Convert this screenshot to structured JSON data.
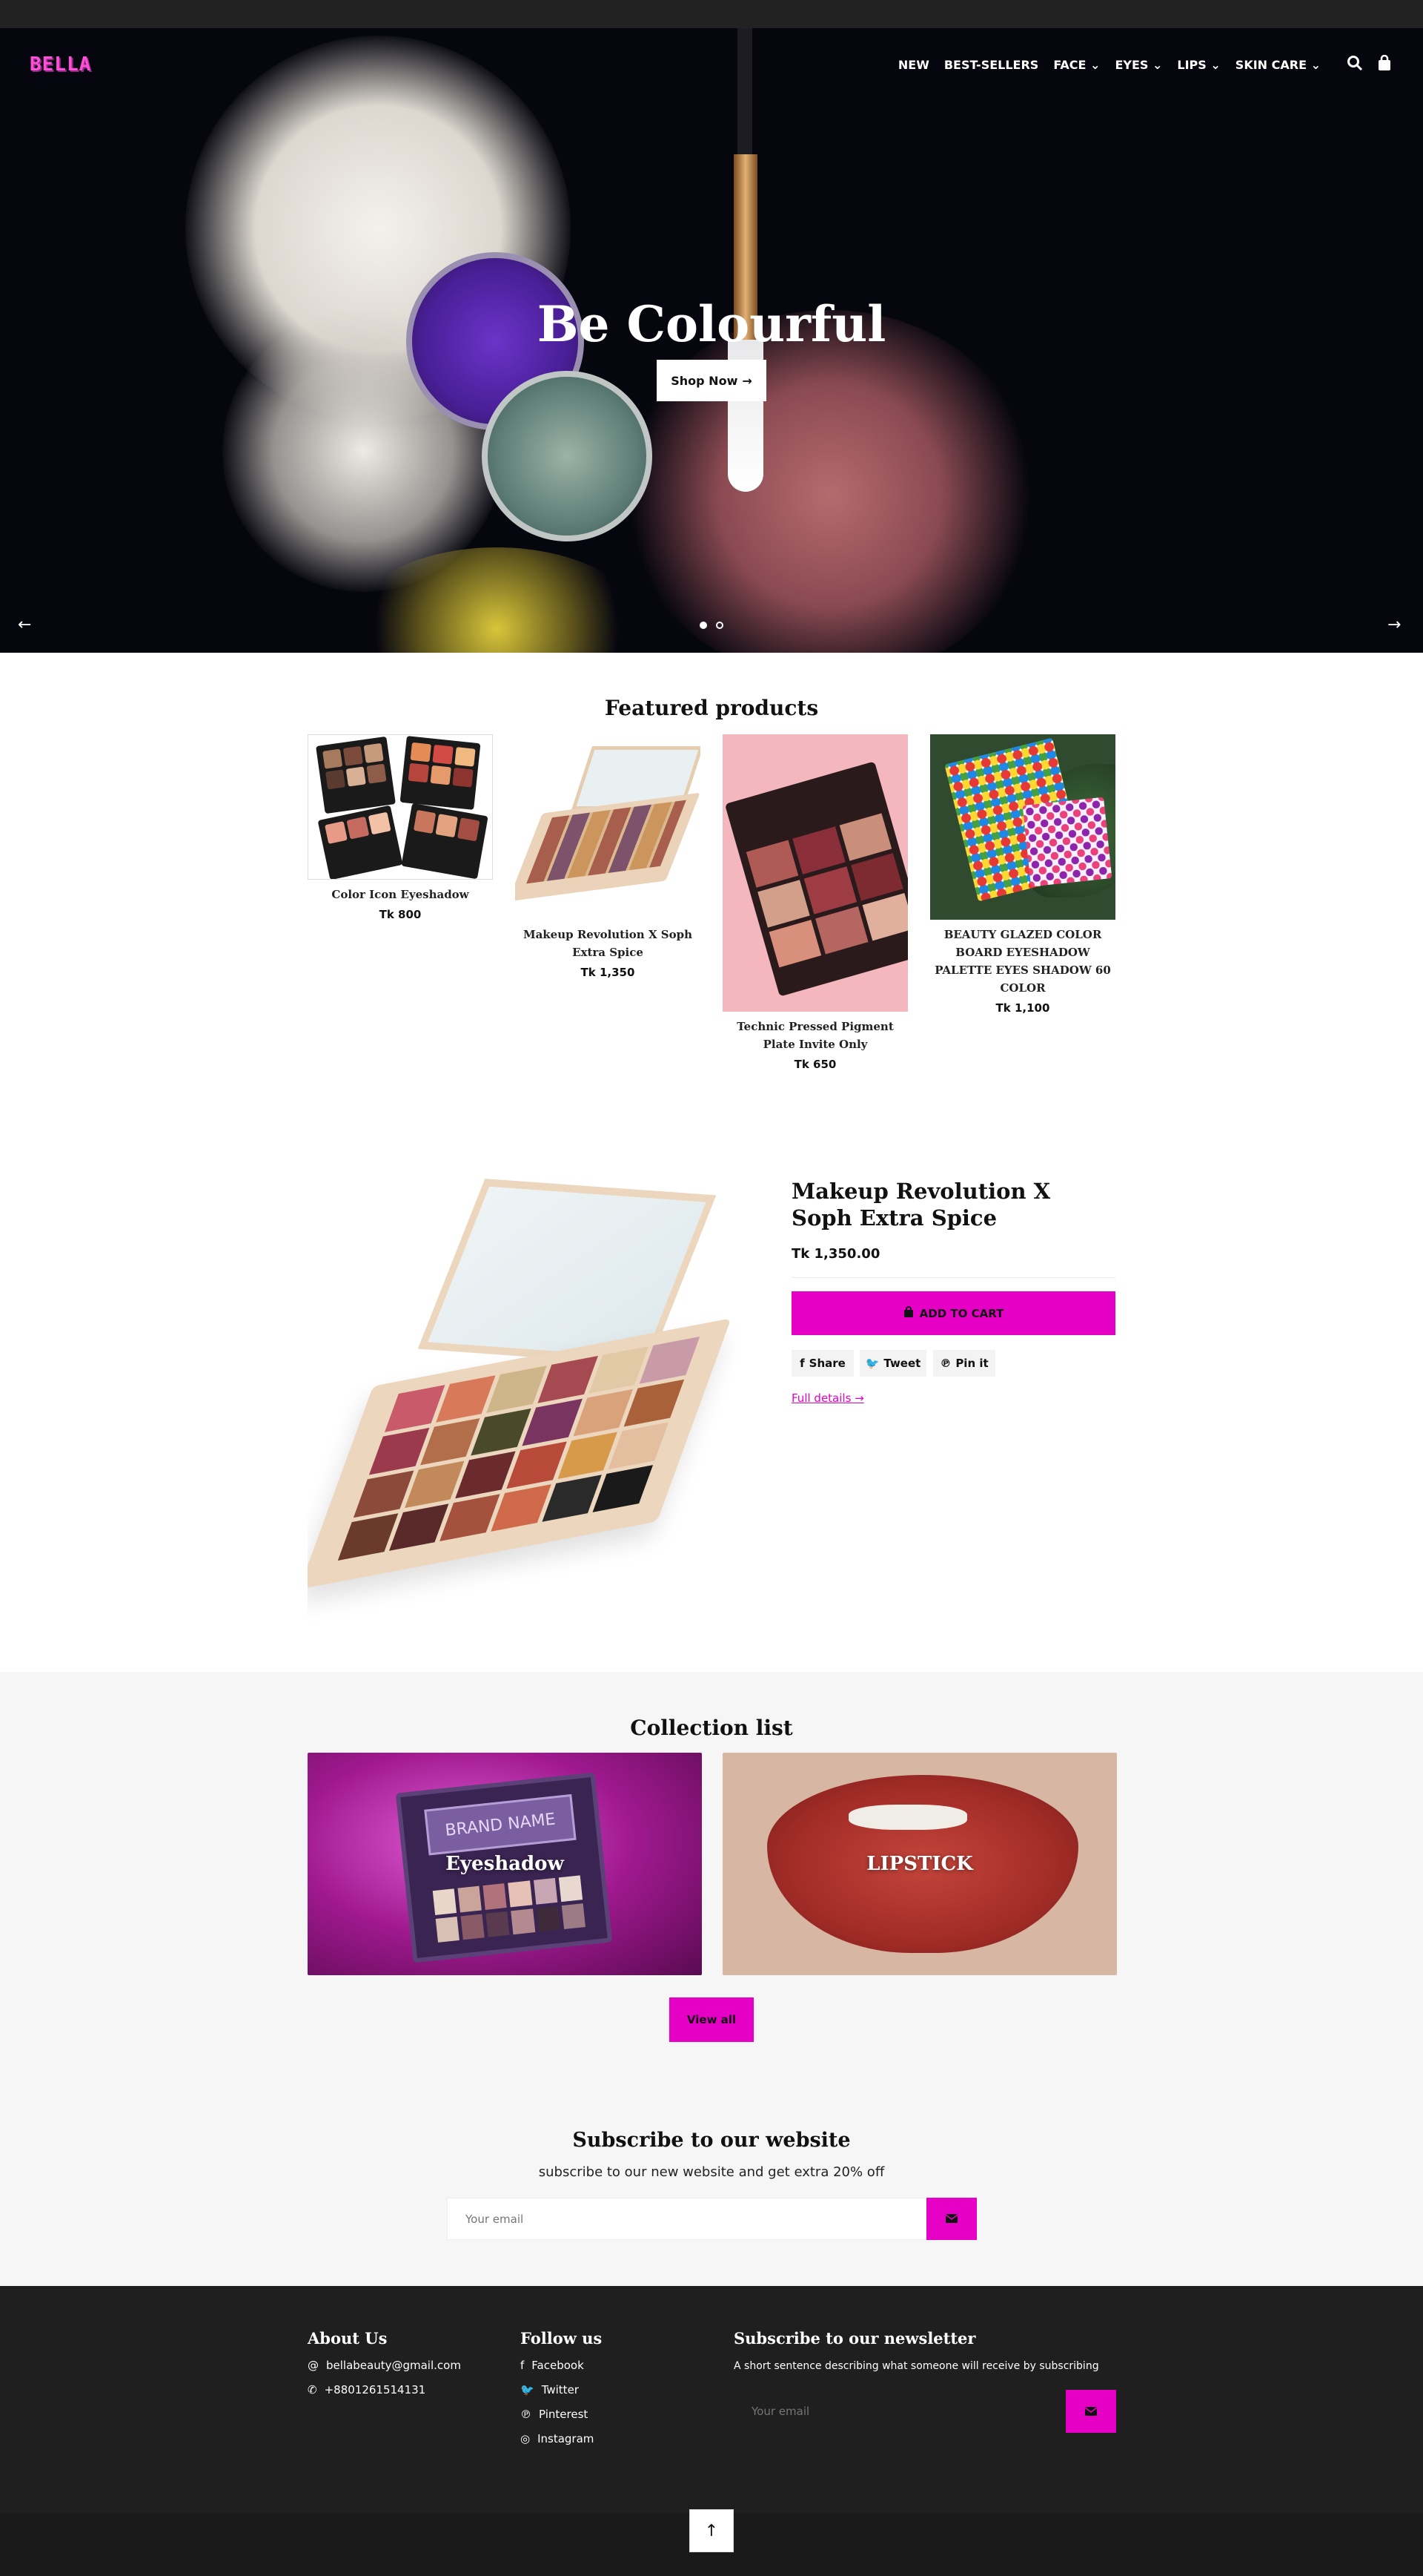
{
  "brand": {
    "logo": "BELLA",
    "accent": "#e600c5"
  },
  "nav": {
    "items": [
      "NEW",
      "BEST-SELLERS",
      "FACE",
      "EYES",
      "LIPS",
      "SKIN CARE"
    ],
    "dropdown_items": [
      "FACE",
      "EYES",
      "LIPS",
      "SKIN CARE"
    ],
    "icons": [
      "search-icon",
      "bag-icon"
    ]
  },
  "hero": {
    "title": "Be Colourful",
    "button": "Shop Now",
    "slides": 2,
    "active_slide": 1
  },
  "featured": {
    "title": "Featured products",
    "products": [
      {
        "name": "Color Icon Eyeshadow",
        "price": "Tk 800"
      },
      {
        "name": "Makeup Revolution X Soph Extra Spice",
        "price": "Tk 1,350"
      },
      {
        "name": "Technic Pressed Pigment Plate Invite Only",
        "price": "Tk 650"
      },
      {
        "name": "BEAUTY GLAZED COLOR BOARD EYESHADOW PALETTE EYES SHADOW 60 COLOR",
        "price": "Tk 1,100"
      }
    ]
  },
  "product_detail": {
    "title": "Makeup Revolution X Soph Extra Spice",
    "price": "Tk 1,350.00",
    "add_to_cart": "ADD TO CART",
    "share": "Share",
    "tweet": "Tweet",
    "pin": "Pin it",
    "full_details": "Full details"
  },
  "collection": {
    "title": "Collection list",
    "items": [
      {
        "label": "Eyeshadow"
      },
      {
        "label": "LIPSTICK"
      }
    ],
    "overlay_brand": "BRAND NAME",
    "view_all": "View all"
  },
  "subscribe": {
    "title": "Subscribe to our website",
    "text": "subscribe to our new website and get extra 20% off",
    "placeholder": "Your email"
  },
  "footer": {
    "about": {
      "title": "About Us",
      "email": "bellabeauty@gmail.com",
      "phone": "+8801261514131"
    },
    "follow": {
      "title": "Follow us",
      "links": [
        "Facebook",
        "Twitter",
        "Pinterest",
        "Instagram"
      ]
    },
    "newsletter": {
      "title": "Subscribe to our newsletter",
      "text": "A short sentence describing what someone will receive by subscribing",
      "placeholder": "Your email"
    }
  }
}
